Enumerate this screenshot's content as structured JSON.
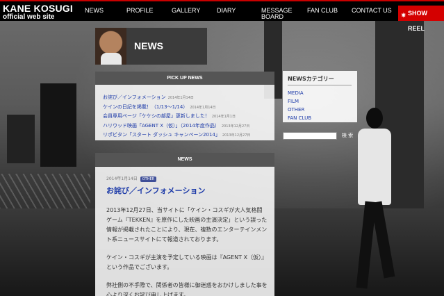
{
  "header": {
    "logo_name": "KANE KOSUGI",
    "logo_sub": "official web site",
    "nav": [
      {
        "label": "NEWS"
      },
      {
        "label": "PROFILE"
      },
      {
        "label": "GALLERY"
      },
      {
        "label": "DIARY"
      },
      {
        "label": "MESSAGE\nBOARD"
      },
      {
        "label": "FAN CLUB"
      },
      {
        "label": "CONTACT US"
      }
    ],
    "show_reel": "SHOW REEL"
  },
  "page": {
    "title": "NEWS"
  },
  "pickup": {
    "heading": "PICK UP NEWS",
    "items": [
      {
        "title": "お詫び／インフォメーション",
        "date": "2014年1月14日"
      },
      {
        "title": "ケインの日記を掲載！（1/13〜1/14）",
        "date": "2014年1月14日"
      },
      {
        "title": "会員専用ページ「ケケシの部屋」更新しました！",
        "date": "2014年1月1日"
      },
      {
        "title": "ハリウッド映画「AGENT X（仮）」（2014年度作品）",
        "date": "2013年12月27日"
      },
      {
        "title": "リポビタン「スタート ダッシュ キャンペーン2014」",
        "date": "2013年12月27日"
      }
    ]
  },
  "news": {
    "heading": "NEWS",
    "date": "2014年1月14日",
    "badge": "OTHER",
    "title": "お詫び／インフォメーション",
    "paragraphs": [
      "2013年12月27日、当サイトに「ケイン・コスギが大人気格闘ゲーム『TEKKEN』を原作にした映画の主演決定」という誤った情報が掲載されたことにより、現在、複数のエンターテインメント系ニュースサイトにて報道されております。",
      "ケイン・コスギが主演を予定している映画は『AGENT X（仮）』という作品でございます。",
      "弊社側の不手際で、関係者の皆様に御迷惑をおかけしました事を心より深くお詫び申し上げます。"
    ]
  },
  "sidebar": {
    "category_title": "NEWSカテゴリー",
    "categories": [
      {
        "label": "MEDIA"
      },
      {
        "label": "FILM"
      },
      {
        "label": "OTHER"
      },
      {
        "label": "FAN CLUB"
      }
    ],
    "search_button": "検 索",
    "search_value": ""
  },
  "colors": {
    "accent_red": "#d40000",
    "link_blue": "#1c3aa8",
    "badge_blue": "#3f4f98"
  }
}
